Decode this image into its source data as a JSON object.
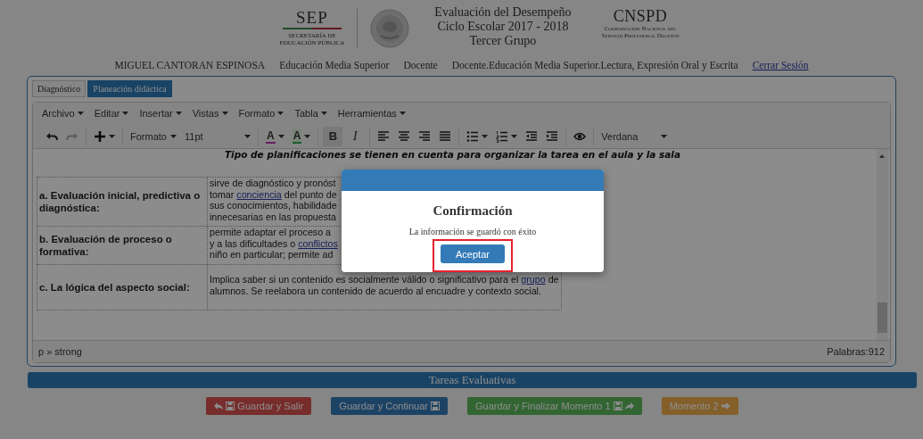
{
  "header": {
    "sep_logo": {
      "title": "SEP",
      "subtitle": [
        "SECRETARÍA DE",
        "EDUCACIÓN PÚBLICA"
      ]
    },
    "titles": [
      "Evaluación del Desempeño",
      "Ciclo Escolar 2017 - 2018",
      "Tercer Grupo"
    ],
    "cnspd_logo": {
      "title": "CNSPD",
      "subtitle": [
        "Coordinación Nacional del",
        "Servicio Profesional Docente"
      ]
    }
  },
  "user_bar": {
    "items": [
      "MIGUEL CANTORAN ESPINOSA",
      "Educación Media Superior",
      "Docente",
      "Docente.Educación Media Superior.Lectura, Expresión Oral y Escrita"
    ],
    "logout": "Cerrar Sesión"
  },
  "tabs": [
    {
      "label": "Diagnóstico",
      "selected": false
    },
    {
      "label": "Planeación didáctica",
      "selected": true
    }
  ],
  "editor": {
    "menu": [
      "Archivo",
      "Editar",
      "Insertar",
      "Vistas",
      "Formato",
      "Tabla",
      "Herramientas"
    ],
    "toolbar": [
      [
        {
          "kind": "undo",
          "disabled": false,
          "pressed": false
        },
        {
          "kind": "redo",
          "disabled": true,
          "pressed": false
        }
      ],
      [
        {
          "kind": "insert",
          "disabled": false,
          "pressed": false
        }
      ],
      [
        {
          "kind": "block-format",
          "label": "Formato",
          "disabled": false,
          "pressed": false
        },
        {
          "kind": "font-size",
          "label": "11pt",
          "disabled": false,
          "pressed": false
        }
      ],
      [
        {
          "kind": "forecolor",
          "label": "A",
          "disabled": false,
          "pressed": false
        },
        {
          "kind": "backcolor",
          "label": "A",
          "disabled": false,
          "pressed": false
        }
      ],
      [
        {
          "kind": "bold",
          "label": "B",
          "disabled": false,
          "pressed": true
        },
        {
          "kind": "italic",
          "label": "I",
          "disabled": false,
          "pressed": false
        }
      ],
      [
        {
          "kind": "align-left",
          "disabled": false,
          "pressed": false
        },
        {
          "kind": "align-center",
          "disabled": false,
          "pressed": false
        },
        {
          "kind": "align-right",
          "disabled": false,
          "pressed": false
        },
        {
          "kind": "align-justify",
          "disabled": false,
          "pressed": false
        }
      ],
      [
        {
          "kind": "bullet-list",
          "disabled": false,
          "pressed": false
        },
        {
          "kind": "number-list",
          "disabled": false,
          "pressed": false
        },
        {
          "kind": "outdent",
          "disabled": false,
          "pressed": false
        },
        {
          "kind": "indent",
          "disabled": false,
          "pressed": false
        }
      ],
      [
        {
          "kind": "preview",
          "disabled": false,
          "pressed": false
        }
      ],
      [
        {
          "kind": "font-family",
          "label": "Verdana",
          "disabled": false,
          "pressed": false
        }
      ]
    ],
    "heading": "Tipo de planificaciones se tienen en cuenta para organizar la tarea en el aula y la sala",
    "rows": [
      {
        "label": "a. Evaluación inicial, predictiva o diagnóstica:",
        "lines": [
          [
            {
              "text": "sirve de diagnóstico y pronóst"
            }
          ],
          [
            {
              "text": "tomar "
            },
            {
              "text": "conciencia",
              "link": true
            },
            {
              "text": " del punto de"
            }
          ],
          [
            {
              "text": "sus conocimientos, habilidade"
            }
          ],
          [
            {
              "text": "innecesarias en las propuesta"
            }
          ]
        ]
      },
      {
        "label": "b. Evaluación de proceso o formativa:",
        "lines": [
          [
            {
              "text": "permite adaptar el proceso a"
            }
          ],
          [
            {
              "text": "y a las dificultades o "
            },
            {
              "text": "conflictos",
              "link": true
            }
          ],
          [
            {
              "text": "niño en particular; permite ad"
            }
          ]
        ]
      },
      {
        "label": "c. La lógica del aspecto social:",
        "lines": [
          [
            {
              "text": "Implica saber si un contenido es socialmente válido o significativo para el "
            },
            {
              "text": "grupo",
              "link": true
            },
            {
              "text": " de"
            }
          ],
          [
            {
              "text": "alumnos. Se reelabora un contenido de acuerdo al encuadre y contexto social."
            }
          ]
        ]
      }
    ],
    "path": "p » strong",
    "word_count": "Palabras:912"
  },
  "section_bar": "Tareas Evaluativas",
  "actions": [
    {
      "label": "Guardar y Salir",
      "kind": "exit"
    },
    {
      "label": "Guardar y Continuar",
      "kind": "continue"
    },
    {
      "label": "Guardar y Finalizar Momento 1",
      "kind": "finish"
    },
    {
      "label": "Momento 2",
      "kind": "next"
    }
  ],
  "modal": {
    "title": "Confirmación",
    "message": "La información se guardó con éxito",
    "button": "Aceptar",
    "highlighted": true
  }
}
